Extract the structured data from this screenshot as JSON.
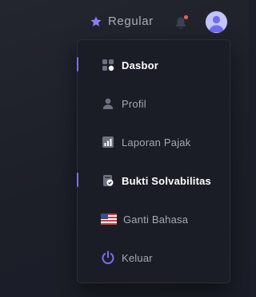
{
  "topbar": {
    "plan_label": "Regular",
    "plan_icon": "star-icon",
    "notification_icon": "bell-icon",
    "has_unread": true,
    "avatar": "user-avatar"
  },
  "menu": {
    "items": [
      {
        "label": "Dasbor",
        "icon": "dashboard-icon",
        "active": true
      },
      {
        "label": "Profil",
        "icon": "user-icon",
        "active": false
      },
      {
        "label": "Laporan Pajak",
        "icon": "bar-chart-icon",
        "active": false
      },
      {
        "label": "Bukti Solvabilitas",
        "icon": "document-check-icon",
        "active": true
      },
      {
        "label": "Ganti Bahasa",
        "icon": "us-flag-icon",
        "active": false
      },
      {
        "label": "Keluar",
        "icon": "power-icon",
        "active": false
      }
    ]
  },
  "colors": {
    "accent": "#7a6ff2",
    "notification_dot": "#ff5b5b",
    "avatar_bg": "#c3c4fb",
    "menu_bg": "#1b1d26"
  }
}
